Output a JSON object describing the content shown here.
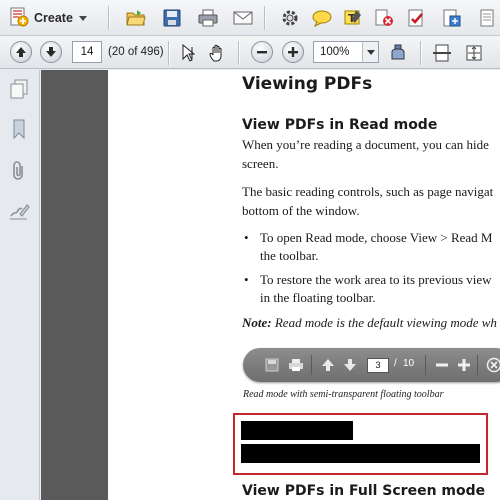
{
  "toolbar": {
    "create_label": "Create",
    "icons": [
      "create-pdf-icon",
      "open-folder-icon",
      "save-icon",
      "print-icon",
      "email-icon",
      "settings-icon",
      "comment-icon",
      "highlight-icon",
      "reject-icon",
      "sign-icon",
      "export-icon"
    ]
  },
  "nav": {
    "page_number": "14",
    "page_count": "(20 of 496)",
    "zoom": "100%"
  },
  "document": {
    "heading": "Viewing PDFs",
    "subheading": "View PDFs in Read mode",
    "para1_line1": "When you’re reading a document, you can hide",
    "para1_line2": "screen.",
    "para2_line1": "The basic reading controls, such as page navigat",
    "para2_line2": "bottom of the window.",
    "bullet1_line1": "To open Read mode, choose View > Read M",
    "bullet1_line2": "the toolbar.",
    "bullet2_line1": "To restore the work area to its previous view",
    "bullet2_line2": "in the floating toolbar.",
    "note_label": "Note:",
    "note_text": "Read mode is the default viewing mode wh",
    "floating_page": "3",
    "floating_sep": "/",
    "floating_total": "10",
    "caption": "Read mode with semi-transparent floating toolbar",
    "next_heading": "View PDFs in Full Screen mode"
  },
  "colors": {
    "highlight_border": "#c8262e",
    "document_background": "#5a5a5a"
  }
}
